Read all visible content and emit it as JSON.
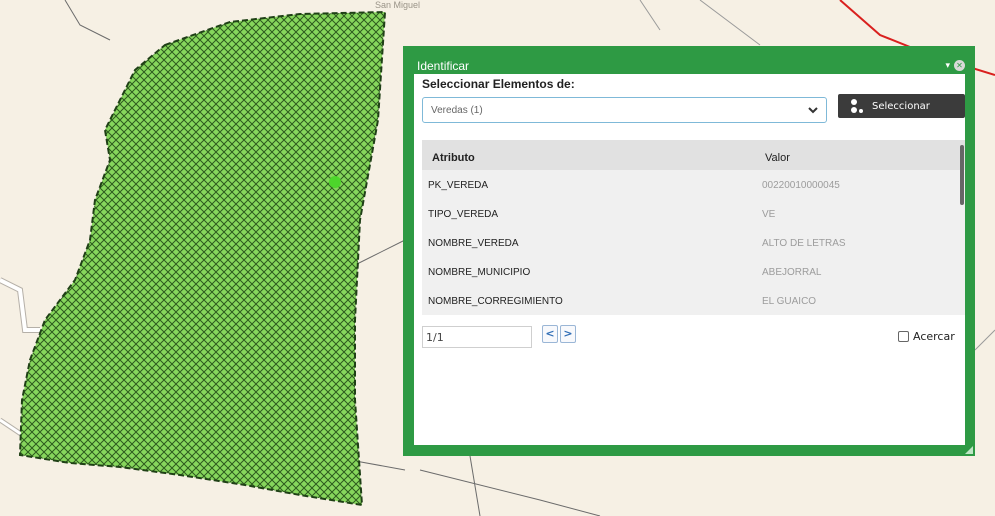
{
  "map": {
    "top_label": "San Miguel"
  },
  "panel": {
    "title": "Identificar",
    "minimize_icon": "minimize-icon",
    "close_icon": "close-icon",
    "select_caption": "Seleccionar Elementos de:",
    "select_value": "Veredas (1)",
    "select_button": "Seleccionar",
    "table": {
      "columns": [
        "Atributo",
        "Valor"
      ],
      "rows": [
        {
          "attr": "PK_VEREDA",
          "value": "00220010000045"
        },
        {
          "attr": "TIPO_VEREDA",
          "value": "VE"
        },
        {
          "attr": "NOMBRE_VEREDA",
          "value": "ALTO DE LETRAS"
        },
        {
          "attr": "NOMBRE_MUNICIPIO",
          "value": "ABEJORRAL"
        },
        {
          "attr": "NOMBRE_CORREGIMIENTO",
          "value": "EL GUAICO"
        }
      ]
    },
    "pager": "1/1",
    "prev": "<",
    "next": ">",
    "zoom_checkbox": "Acercar"
  },
  "colors": {
    "panel_green": "#2e9a44",
    "polygon_fill": "#7ed957",
    "boundary_red": "#d9201e",
    "map_bg": "#f6f0e4"
  }
}
